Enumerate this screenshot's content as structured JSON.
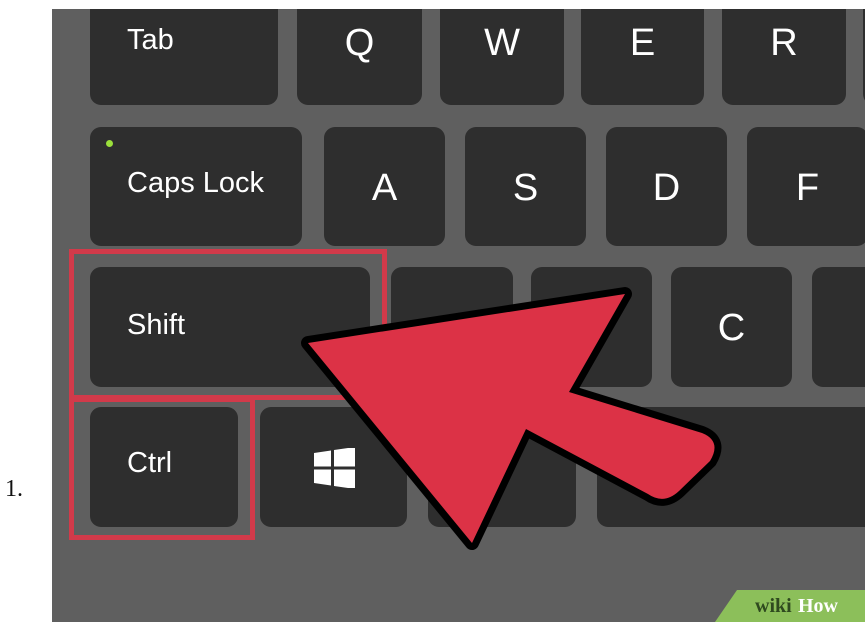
{
  "list_marker": "1.",
  "keys": {
    "tab": "Tab",
    "q": "Q",
    "w": "W",
    "e": "E",
    "r": "R",
    "caps_lock": "Caps Lock",
    "a": "A",
    "s": "S",
    "d": "D",
    "f": "F",
    "shift": "Shift",
    "c": "C",
    "ctrl": "Ctrl"
  },
  "icons": {
    "windows": "windows-logo-icon",
    "pointer": "arrow-pointer-icon",
    "caps_led": "led-indicator-icon"
  },
  "watermark": {
    "prefix": "wiki",
    "suffix": "How"
  },
  "colors": {
    "keyboard_body": "#5f5f5f",
    "key": "#2e2e2e",
    "highlight": "#d23a4a",
    "arrow": "#dc3246",
    "led": "#9be03b",
    "watermark": "#8cbf5a"
  }
}
